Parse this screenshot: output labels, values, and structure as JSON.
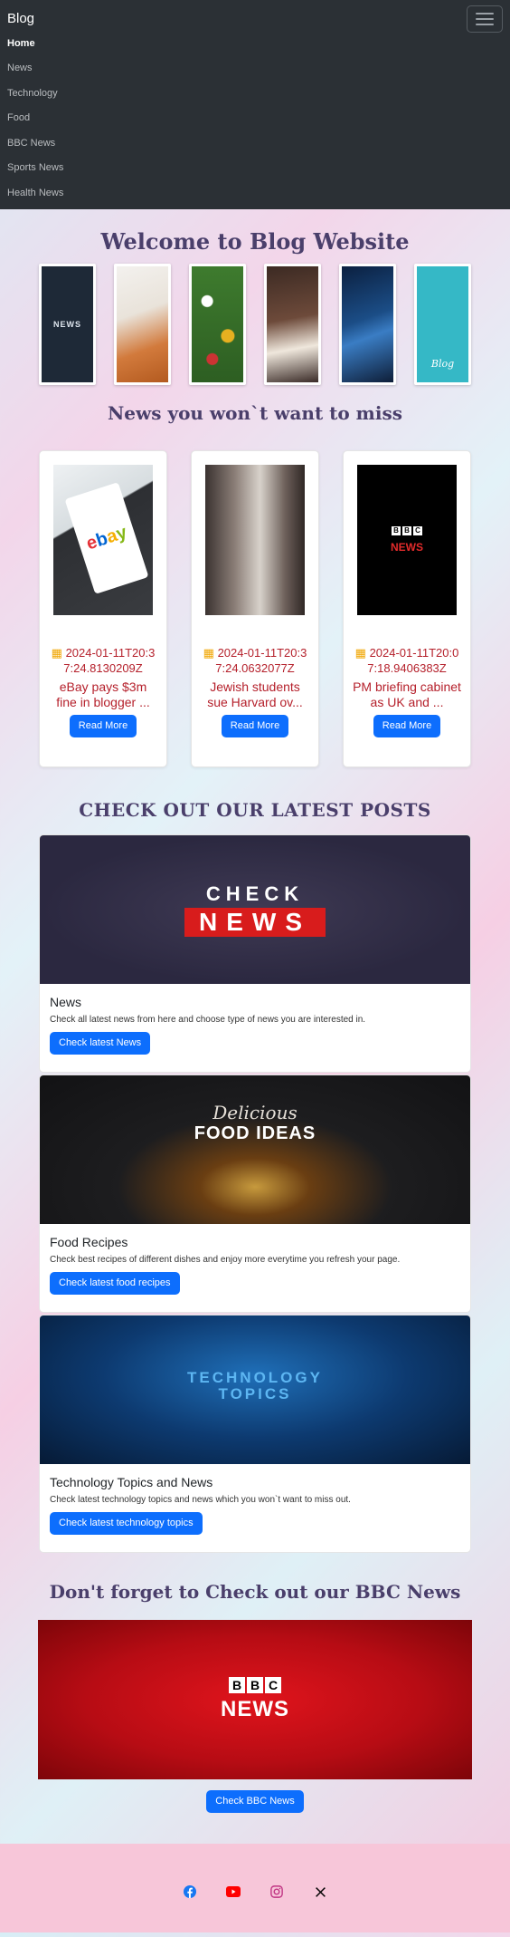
{
  "navbar": {
    "brand": "Blog",
    "items": [
      {
        "label": "Home",
        "active": true
      },
      {
        "label": "News"
      },
      {
        "label": "Technology"
      },
      {
        "label": "Food"
      },
      {
        "label": "BBC News"
      },
      {
        "label": "Sports News"
      },
      {
        "label": "Health News"
      }
    ]
  },
  "welcome": {
    "title": "Welcome to Blog Website",
    "thumb_texts": {
      "bbc": "NEWS",
      "blog": "Blog"
    }
  },
  "miss": {
    "title": "News you won`t want to miss",
    "cards": [
      {
        "date": "2024-01-11T20:37:24.8130209Z",
        "title": "eBay pays $3m fine in blogger ...",
        "button": "Read More",
        "image_text": "ebay"
      },
      {
        "date": "2024-01-11T20:37:24.0632077Z",
        "title": "Jewish students sue Harvard ov...",
        "button": "Read More"
      },
      {
        "date": "2024-01-11T20:07:18.9406383Z",
        "title": "PM briefing cabinet as UK and ...",
        "button": "Read More",
        "image_text": "NEWS"
      }
    ]
  },
  "latest": {
    "title": "CHECK OUT OUR LATEST POSTS",
    "posts": [
      {
        "banner_line1": "CHECK",
        "banner_line2": "NEWS",
        "title": "News",
        "text": "Check all latest news from here and choose type of news you are interested in.",
        "button": "Check latest News"
      },
      {
        "banner_line1": "Delicious",
        "banner_line2": "FOOD IDEAS",
        "title": "Food Recipes",
        "text": "Check best recipes of different dishes and enjoy more everytime you refresh your page.",
        "button": "Check latest food recipes"
      },
      {
        "banner_line1": "TECHNOLOGY",
        "banner_line2": "TOPICS",
        "title": "Technology Topics and News",
        "text": "Check latest technology topics and news which you won`t want to miss out.",
        "button": "Check latest technology topics"
      }
    ]
  },
  "bbc": {
    "title": "Don't forget to Check out our BBC News",
    "banner_text": "NEWS",
    "button": "Check BBC News"
  },
  "footer": {
    "icons": [
      "facebook-icon",
      "youtube-icon",
      "instagram-icon",
      "x-icon"
    ]
  }
}
